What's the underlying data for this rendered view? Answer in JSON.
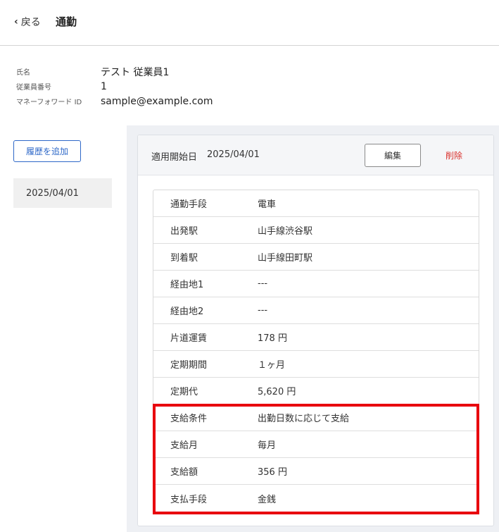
{
  "header": {
    "back_label": "戻る",
    "title": "通勤"
  },
  "employee": [
    {
      "label": "氏名",
      "value": "テスト 従業員1"
    },
    {
      "label": "従業員番号",
      "value": "1"
    },
    {
      "label": "マネーフォワード ID",
      "value": "sample@example.com"
    }
  ],
  "sidebar": {
    "add_button": "履歴を追加",
    "history_date": "2025/04/01"
  },
  "card": {
    "start_label": "適用開始日",
    "start_value": "2025/04/01",
    "edit_label": "編集",
    "delete_label": "削除",
    "rows": [
      {
        "label": "通勤手段",
        "value": "電車"
      },
      {
        "label": "出発駅",
        "value": "山手線渋谷駅"
      },
      {
        "label": "到着駅",
        "value": "山手線田町駅"
      },
      {
        "label": "経由地1",
        "value": "---"
      },
      {
        "label": "経由地2",
        "value": "---"
      },
      {
        "label": "片道運賃",
        "value": "178 円"
      },
      {
        "label": "定期期間",
        "value": "１ヶ月"
      },
      {
        "label": "定期代",
        "value": "5,620 円"
      },
      {
        "label": "支給条件",
        "value": "出勤日数に応じて支給"
      },
      {
        "label": "支給月",
        "value": "毎月"
      },
      {
        "label": "支給額",
        "value": "356 円"
      },
      {
        "label": "支払手段",
        "value": "金銭"
      }
    ]
  },
  "colors": {
    "accent": "#2e68c8",
    "danger": "#d9302c",
    "highlight": "#e8000e"
  }
}
